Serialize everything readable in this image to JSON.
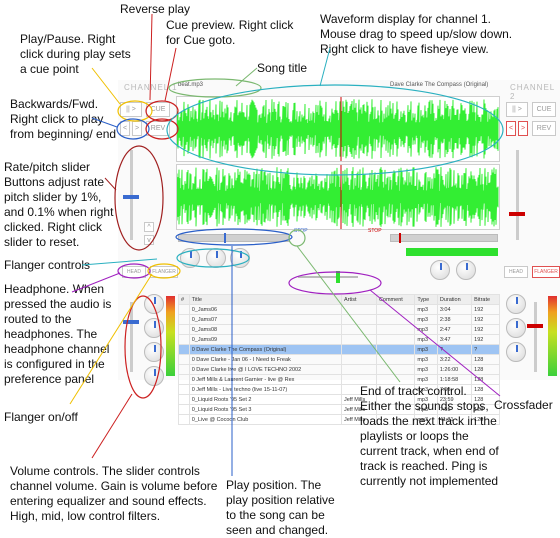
{
  "mixer": {
    "channel1_label": "CHANNEL 1",
    "channel2_label": "CHANNEL 2",
    "song_title_short": "beat.mp3",
    "track_artist_title": "Dave Clarke  The Compass (Original)",
    "buttons": {
      "play": "||  >",
      "cue": "CUE",
      "back": "<",
      "fwd": ">",
      "rev": "REV"
    },
    "stop_label": "STOP",
    "stop_sub": "NEXT\nLOOP",
    "flanger_label": "FLANGER",
    "head_label": "HEAD",
    "colors": {
      "waveform": "#33ee33",
      "marker": "#cc0000",
      "accent": "#3a6bd0"
    },
    "table": {
      "headers": [
        "#",
        "Title",
        "Artist",
        "Comment",
        "Type",
        "Duration",
        "Bitrate"
      ],
      "rows": [
        [
          "",
          "0_Jams06",
          "",
          "",
          "mp3",
          "3:04",
          "192"
        ],
        [
          "",
          "0_Jams07",
          "",
          "",
          "mp3",
          "2:38",
          "192"
        ],
        [
          "",
          "0_Jams08",
          "",
          "",
          "mp3",
          "2:47",
          "192"
        ],
        [
          "",
          "0_Jams09",
          "",
          "",
          "mp3",
          "3:47",
          "192"
        ],
        [
          "",
          "0 Dave Clarke  The Compass (Original)",
          "",
          "",
          "mp3",
          "?",
          "?"
        ],
        [
          "",
          "0 Dave Clarke - Jan 06 - I Need to Freak",
          "",
          "",
          "mp3",
          "3:22",
          "128"
        ],
        [
          "",
          "0 Dave Clarke live @ I LOVE TECHNO 2002",
          "",
          "",
          "mp3",
          "1:26:00",
          "128"
        ],
        [
          "",
          "0 Jeff Mills & Laurent Garnier - live @ Rex",
          "",
          "",
          "mp3",
          "1:18:58",
          "128"
        ],
        [
          "",
          "0 Jeff Mills - Live techno (live 15-11-07)",
          "",
          "",
          "mp3",
          "7:55",
          "128"
        ],
        [
          "",
          "0_Liquid Roots '95 Set 2",
          "Jeff Mills",
          "",
          "mp3",
          "23:59",
          "128"
        ],
        [
          "",
          "0_Liquid Roots '95 Set 3",
          "Jeff Mills",
          "",
          "mp3",
          "7:55",
          "128"
        ],
        [
          "",
          "0_Live @ Cocoon Club",
          "Jeff Mills",
          "",
          "mp3",
          "41:31",
          "128"
        ]
      ]
    },
    "play_position": 0.42,
    "end_position": 0.7
  },
  "annotations": {
    "reverse_play": "Reverse play",
    "cue_preview": "Cue preview. Right click for Cue goto.",
    "waveform": "Waveform display for channel 1. Mouse drag to speed up/slow down. Right click to have fisheye view.",
    "play_pause": "Play/Pause. Right click during play sets a cue point",
    "song_title": "Song title",
    "back_fwd": "Backwards/Fwd. Right click to play from beginning/ end",
    "rate_slider": "Rate/pitch slider Buttons adjust rate pitch slider by 1%, and 0.1% when right clicked. Right click slider to reset.",
    "flanger_controls": "Flanger controls",
    "headphone": "Headphone. When pressed the audio is routed to the headphones. The headphone channel is configured in the preference panel",
    "flanger_onoff": "Flanger on/off",
    "volume": "Volume controls. The slider controls channel volume. Gain is volume before entering equalizer and sound effects. High, mid, low control filters.",
    "play_position": "Play position. The play position relative to the song can be seen and changed.",
    "end_of_track": "End of track control. Either the sounds stops, loads the next track in the playlists or loops the current track, when end of track is reached. Ping is currently not implemented",
    "crossfader": "Crossfader"
  }
}
